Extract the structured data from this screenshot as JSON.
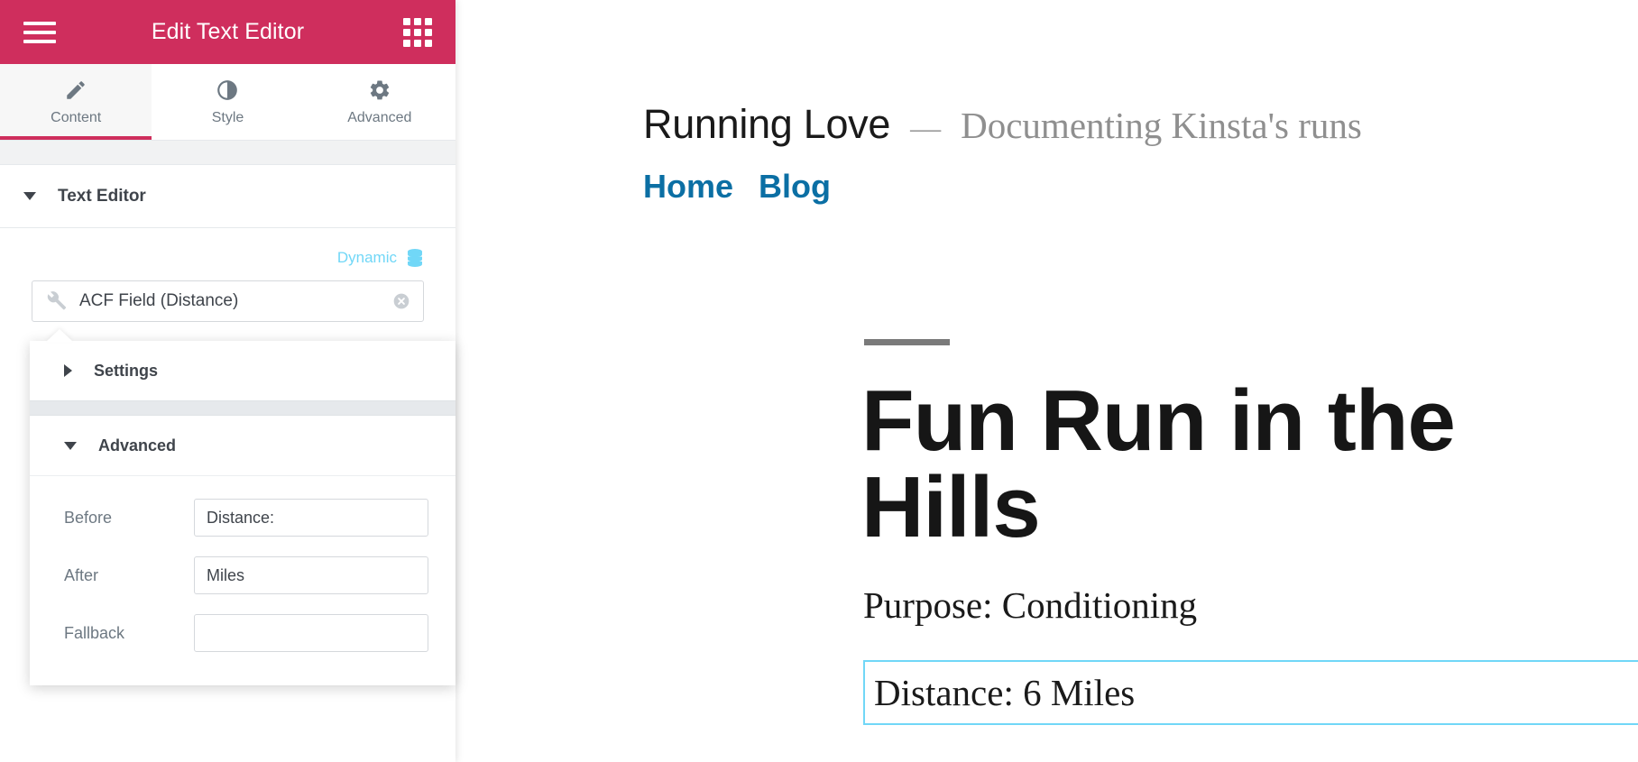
{
  "panel": {
    "header": {
      "title": "Edit Text Editor",
      "menu_icon": "hamburger-icon",
      "widgets_icon": "grid-icon"
    },
    "tabs": [
      {
        "label": "Content",
        "icon": "pencil-icon",
        "active": true
      },
      {
        "label": "Style",
        "icon": "contrast-icon",
        "active": false
      },
      {
        "label": "Advanced",
        "icon": "gear-icon",
        "active": false
      }
    ],
    "section": {
      "title": "Text Editor",
      "expanded": true
    },
    "dynamic": {
      "label": "Dynamic",
      "icon": "database-stack-icon",
      "tag_value": "ACF Field (Distance)",
      "tag_icon": "wrench-icon",
      "clear_icon": "close-circle-icon"
    },
    "popup": {
      "settings": {
        "label": "Settings",
        "expanded": false
      },
      "advanced": {
        "label": "Advanced",
        "expanded": true
      },
      "fields": [
        {
          "label": "Before",
          "value": "Distance:",
          "placeholder": ""
        },
        {
          "label": "After",
          "value": "Miles",
          "placeholder": ""
        },
        {
          "label": "Fallback",
          "value": "",
          "placeholder": ""
        }
      ]
    }
  },
  "preview": {
    "site": {
      "title": "Running Love",
      "dash": "—",
      "tagline": "Documenting Kinsta's runs",
      "nav": [
        {
          "label": "Home"
        },
        {
          "label": "Blog"
        }
      ]
    },
    "post": {
      "title": "Fun Run in the Hills",
      "meta": "Purpose: Conditioning",
      "widget_text": "Distance: 6 Miles"
    },
    "collapse_icon": "chevron-left-icon"
  },
  "colors": {
    "brand_pink": "#cf2e5d",
    "dynamic_blue": "#71d7f7",
    "link_blue": "#0b6fa4",
    "text_dark": "#3f444b",
    "label_gray": "#6d7882"
  }
}
